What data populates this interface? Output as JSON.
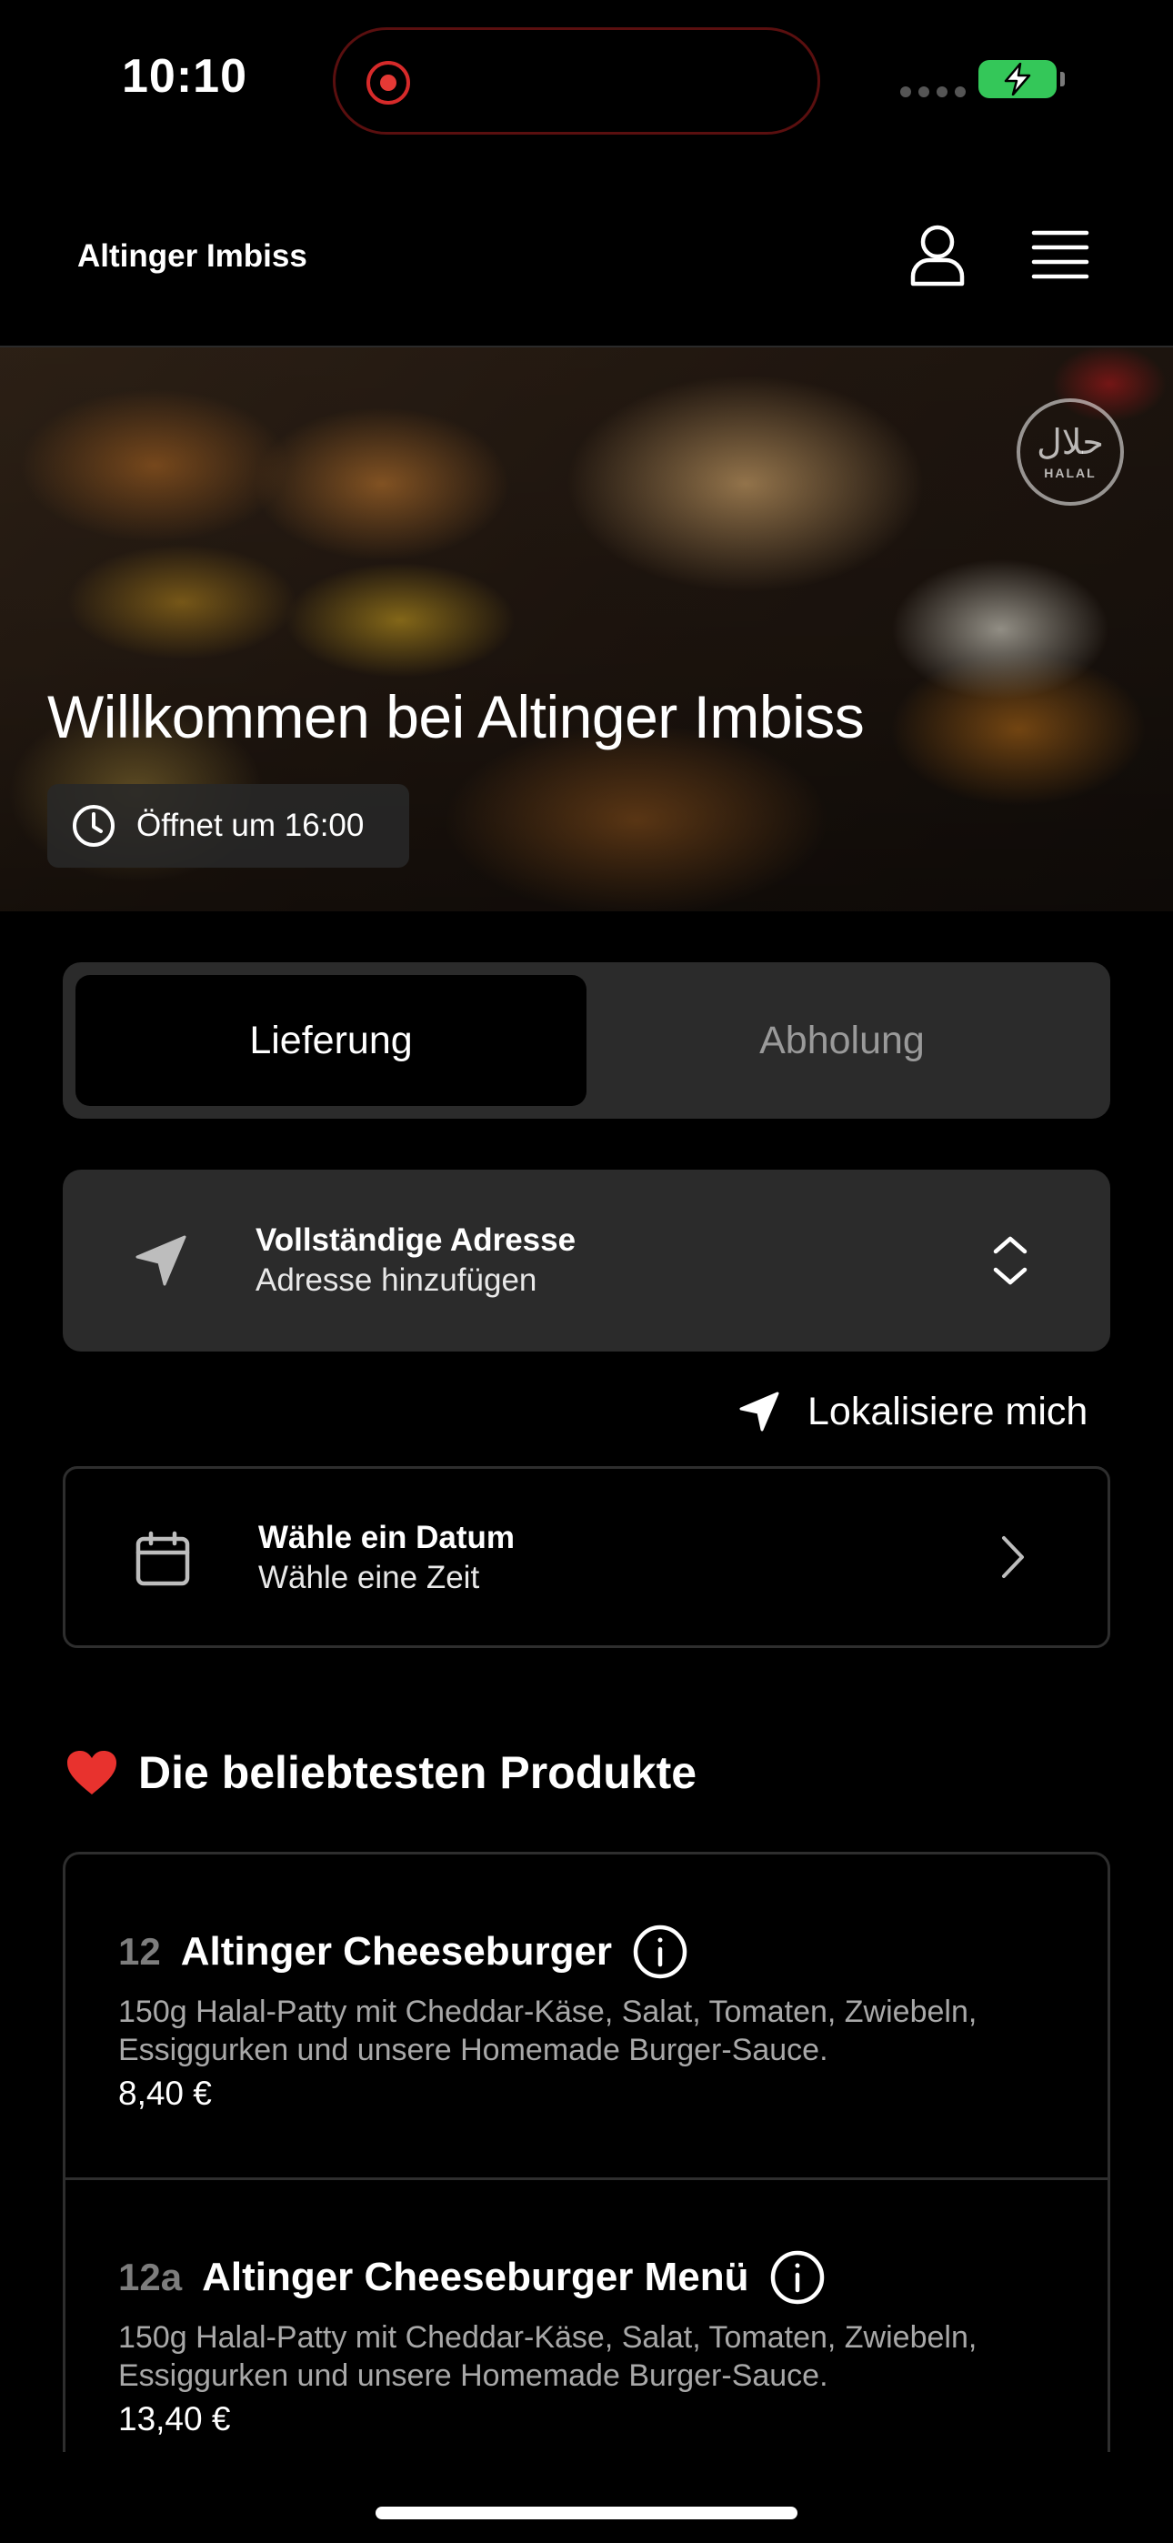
{
  "status_bar": {
    "time": "10:10"
  },
  "header": {
    "brand": "Altinger Imbiss"
  },
  "hero": {
    "title": "Willkommen bei Altinger Imbiss",
    "open_status": "Öffnet um 16:00",
    "halal_arabic": "حلال",
    "halal_label": "HALAL"
  },
  "order_mode": {
    "options": [
      "Lieferung",
      "Abholung"
    ],
    "selected": "Lieferung"
  },
  "address": {
    "title": "Vollständige Adresse",
    "subtitle": "Adresse hinzufügen"
  },
  "locate": {
    "label": "Lokalisiere mich"
  },
  "schedule": {
    "title": "Wähle ein Datum",
    "subtitle": "Wähle eine Zeit"
  },
  "popular": {
    "heading": "Die beliebtesten Produkte",
    "items": [
      {
        "number": "12",
        "name": "Altinger Cheeseburger",
        "description": "150g Halal-Patty mit Cheddar-Käse, Salat, Tomaten, Zwiebeln, Essiggurken und unsere Homemade Burger-Sauce.",
        "price": "8,40 €"
      },
      {
        "number": "12a",
        "name": "Altinger Cheeseburger Menü",
        "description": "150g Halal-Patty mit Cheddar-Käse, Salat, Tomaten, Zwiebeln, Essiggurken und unsere Homemade Burger-Sauce.",
        "price": "13,40 €"
      }
    ]
  },
  "colors": {
    "background": "#000000",
    "card": "#2b2b2b",
    "muted_text": "#9a9a9a",
    "battery": "#34c759",
    "recording": "#e53935"
  }
}
